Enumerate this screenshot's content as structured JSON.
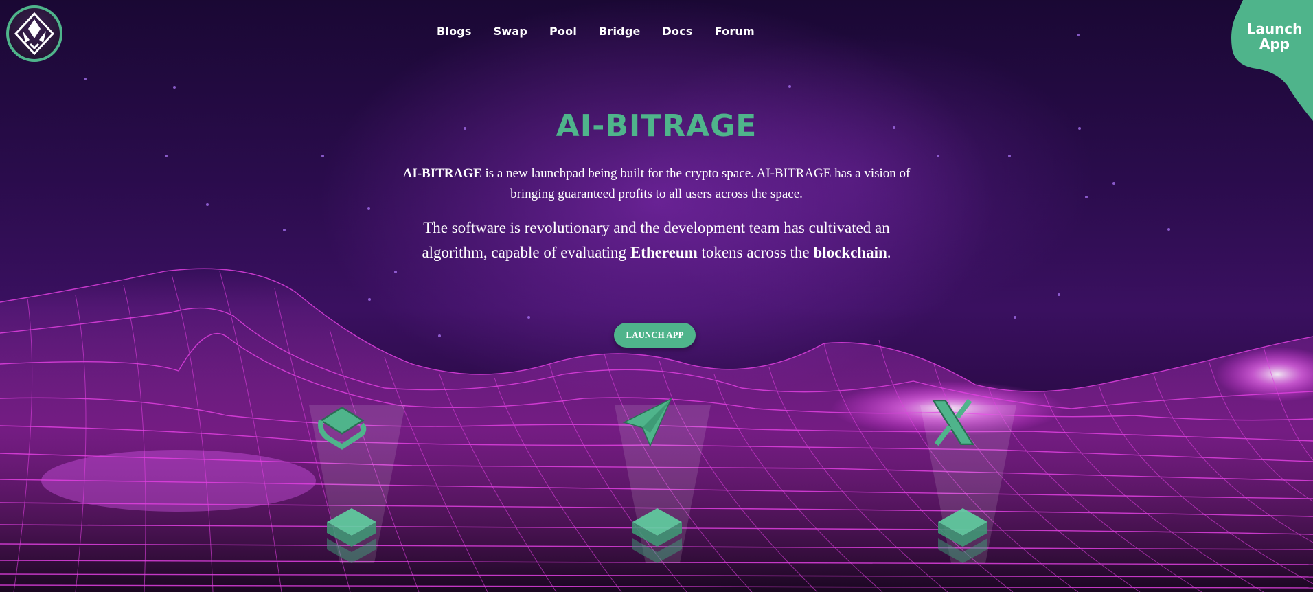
{
  "colors": {
    "accent": "#4fb48b",
    "nav_text": "#ffffff",
    "grid": "#e040e0"
  },
  "logo": {
    "icon": "diamond-crest-logo"
  },
  "nav": {
    "items": [
      {
        "label": "Blogs"
      },
      {
        "label": "Swap"
      },
      {
        "label": "Pool"
      },
      {
        "label": "Bridge"
      },
      {
        "label": "Docs"
      },
      {
        "label": "Forum"
      }
    ]
  },
  "corner_launch": {
    "line1": "Launch",
    "line2": "App"
  },
  "hero": {
    "title": "AI-BITRAGE",
    "p1_bold": "AI-BITRAGE",
    "p1_text": " is a new launchpad being built for the crypto space. AI-BITRAGE has a vision of bringing guaranteed profits to all users across the space.",
    "p2_text_a": "The software is revolutionary and the development team has cultivated an algorithm, capable of evaluating ",
    "p2_bold_a": "Ethereum",
    "p2_text_b": " tokens across the ",
    "p2_bold_b": "blockchain",
    "p2_text_c": ".",
    "cta_label": "LAUNCH APP"
  },
  "socials": [
    {
      "icon": "gitbook-icon"
    },
    {
      "icon": "telegram-icon"
    },
    {
      "icon": "x-twitter-icon"
    }
  ]
}
